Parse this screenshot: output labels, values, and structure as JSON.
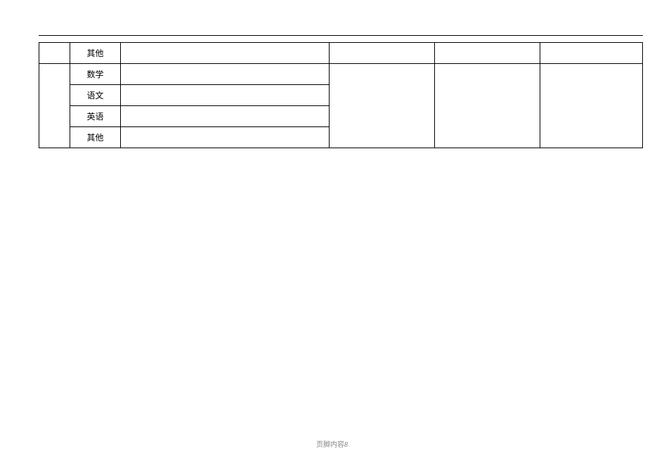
{
  "header_mark": "",
  "rows": {
    "r0": {
      "subject": "其他"
    },
    "r1": {
      "subject": "数学"
    },
    "r2": {
      "subject": "语文"
    },
    "r3": {
      "subject": "英语"
    },
    "r4": {
      "subject": "其他"
    }
  },
  "footer": {
    "label": "页脚内容",
    "page": "8"
  },
  "small_mark": ""
}
